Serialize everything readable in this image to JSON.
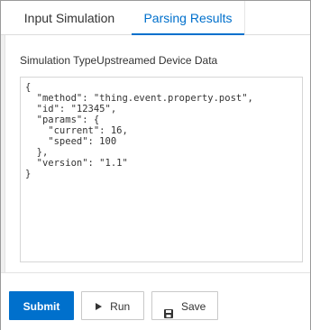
{
  "tabs": [
    {
      "label": "Input Simulation",
      "active": false
    },
    {
      "label": "Parsing Results",
      "active": true
    }
  ],
  "section": {
    "label": "Simulation TypeUpstreamed Device Data"
  },
  "code": {
    "lines": [
      "{",
      "  \"method\": \"thing.event.property.post\",",
      "  \"id\": \"12345\",",
      "  \"params\": {",
      "    \"current\": 16,",
      "    \"speed\": 100",
      "  },",
      "  \"version\": \"1.1\"",
      "}"
    ]
  },
  "footer": {
    "submit_label": "Submit",
    "run_label": "Run",
    "save_label": "Save",
    "run_icon": "play-icon",
    "save_icon": "save-icon"
  },
  "colors": {
    "accent": "#0070cc",
    "text": "#333333",
    "border": "#d6d6d6"
  }
}
